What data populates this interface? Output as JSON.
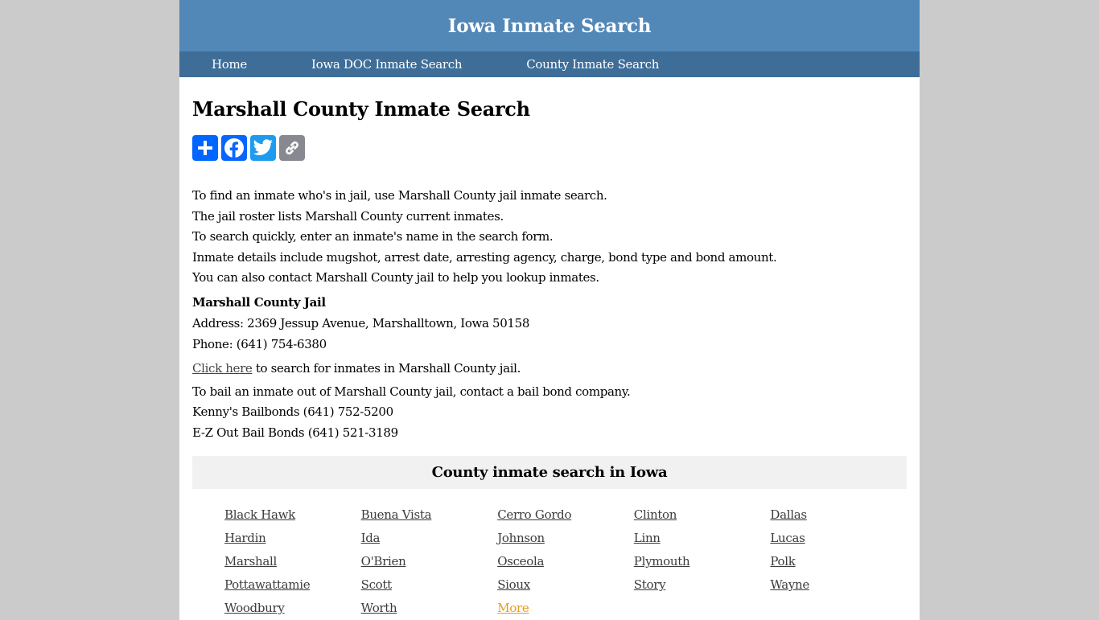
{
  "site": {
    "title": "Iowa Inmate Search"
  },
  "nav": [
    {
      "label": "Home"
    },
    {
      "label": "Iowa DOC Inmate Search"
    },
    {
      "label": "County Inmate Search"
    }
  ],
  "page": {
    "title": "Marshall County Inmate Search"
  },
  "share": [
    {
      "icon": "plus-icon",
      "label": "Share"
    },
    {
      "icon": "facebook-icon",
      "label": "Facebook"
    },
    {
      "icon": "twitter-icon",
      "label": "Twitter"
    },
    {
      "icon": "link-icon",
      "label": "Copy Link"
    }
  ],
  "intro": [
    "To find an inmate who's in jail, use Marshall County jail inmate search.",
    "The jail roster lists Marshall County current inmates.",
    "To search quickly, enter an inmate's name in the search form.",
    "Inmate details include mugshot, arrest date, arresting agency, charge, bond type and bond amount.",
    "You can also contact Marshall County jail to help you lookup inmates."
  ],
  "jail": {
    "name": "Marshall County Jail",
    "address": "Address: 2369 Jessup Avenue, Marshalltown, Iowa 50158",
    "phone": "Phone: (641) 754-6380"
  },
  "click": {
    "link": "Click here",
    "text": " to search for inmates in Marshall County jail."
  },
  "bail": [
    "To bail an inmate out of Marshall County jail, contact a bail bond company.",
    "Kenny's Bailbonds (641) 752-5200",
    "E-Z Out Bail Bonds (641) 521-3189"
  ],
  "counties": {
    "heading": "County inmate search in Iowa",
    "items": [
      "Black Hawk",
      "Buena Vista",
      "Cerro Gordo",
      "Clinton",
      "Dallas",
      "Hardin",
      "Ida",
      "Johnson",
      "Linn",
      "Lucas",
      "Marshall",
      "O'Brien",
      "Osceola",
      "Plymouth",
      "Polk",
      "Pottawattamie",
      "Scott",
      "Sioux",
      "Story",
      "Wayne",
      "Woodbury",
      "Worth",
      "More"
    ],
    "more_color": "#e89a1b"
  },
  "colors": {
    "header": "#5288b8",
    "nav": "#3e6d98",
    "background": "#cbcbcb"
  }
}
